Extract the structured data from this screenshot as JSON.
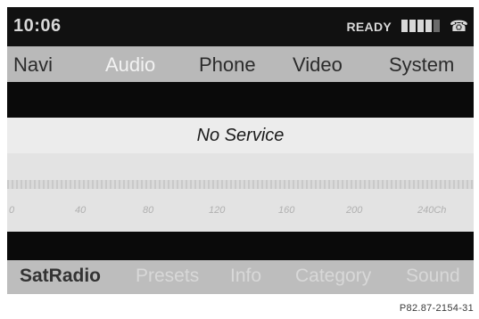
{
  "status_bar": {
    "time": "10:06",
    "ready": "READY",
    "signal_bars_filled": 4,
    "signal_bars_total": 5
  },
  "main_menu": {
    "navi": "Navi",
    "audio": "Audio",
    "phone": "Phone",
    "video": "Video",
    "system": "System",
    "active": "Audio"
  },
  "status_area": {
    "text": "No Service"
  },
  "scale": {
    "ticks": [
      "0",
      "40",
      "80",
      "120",
      "160",
      "200",
      "240Ch"
    ]
  },
  "bottom_menu": {
    "satradio": "SatRadio",
    "presets": "Presets",
    "info": "Info",
    "category": "Category",
    "sound": "Sound",
    "active": "SatRadio"
  },
  "image_code": "P82.87-2154-31",
  "icons": {
    "phone": "phone-handset-icon"
  }
}
